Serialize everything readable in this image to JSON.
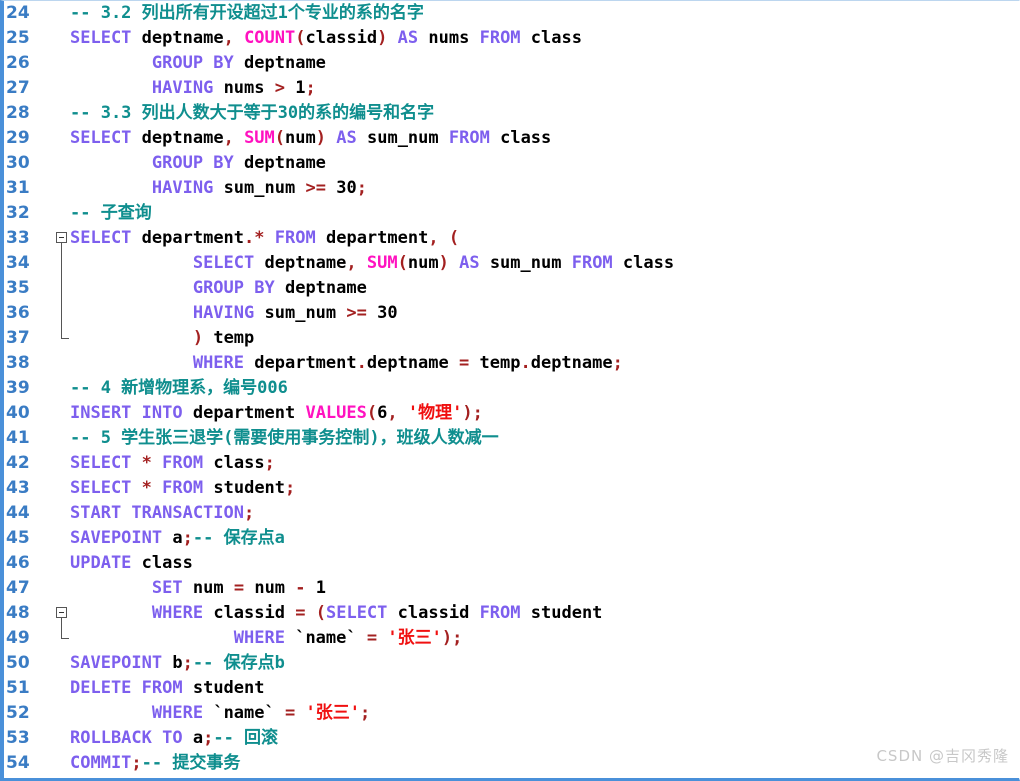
{
  "editor": {
    "language": "sql",
    "first_line": 24,
    "last_line": 54,
    "colors": {
      "background": "#ffffff",
      "line_number": "#3a7cc4",
      "comment": "#0f8e8e",
      "keyword": "#7d5fee",
      "function": "#ff12c0",
      "identifier": "#000000",
      "operator": "#a32020",
      "string": "#f01010",
      "border": "#4a90d9",
      "watermark": "#c8c8c8"
    }
  },
  "watermark": {
    "text": "CSDN @吉冈秀隆"
  },
  "fold_markers": [
    {
      "line": 33,
      "state": "expanded",
      "ends_at_line": 37
    },
    {
      "line": 48,
      "state": "expanded",
      "ends_at_line": 49
    }
  ],
  "lines": [
    {
      "no": "24",
      "plain": "-- 3.2 列出所有开设超过1个专业的系的名字",
      "tokens": [
        {
          "t": "-- 3.2 列出所有开设超过1个专业的系的名字",
          "c": "cm"
        }
      ]
    },
    {
      "no": "25",
      "plain": "SELECT deptname, COUNT(classid) AS nums FROM class",
      "tokens": [
        {
          "t": "SELECT",
          "c": "kw"
        },
        {
          "t": " ",
          "c": "id"
        },
        {
          "t": "deptname",
          "c": "id"
        },
        {
          "t": ",",
          "c": "op"
        },
        {
          "t": " ",
          "c": "id"
        },
        {
          "t": "COUNT",
          "c": "fn"
        },
        {
          "t": "(",
          "c": "op"
        },
        {
          "t": "classid",
          "c": "id"
        },
        {
          "t": ")",
          "c": "op"
        },
        {
          "t": " ",
          "c": "id"
        },
        {
          "t": "AS",
          "c": "kw"
        },
        {
          "t": " ",
          "c": "id"
        },
        {
          "t": "nums",
          "c": "id"
        },
        {
          "t": " ",
          "c": "id"
        },
        {
          "t": "FROM",
          "c": "kw"
        },
        {
          "t": " ",
          "c": "id"
        },
        {
          "t": "class",
          "c": "id"
        }
      ]
    },
    {
      "no": "26",
      "plain": "        GROUP BY deptname",
      "tokens": [
        {
          "t": "        ",
          "c": "id"
        },
        {
          "t": "GROUP BY",
          "c": "kw"
        },
        {
          "t": " ",
          "c": "id"
        },
        {
          "t": "deptname",
          "c": "id"
        }
      ]
    },
    {
      "no": "27",
      "plain": "        HAVING nums > 1;",
      "tokens": [
        {
          "t": "        ",
          "c": "id"
        },
        {
          "t": "HAVING",
          "c": "kw"
        },
        {
          "t": " ",
          "c": "id"
        },
        {
          "t": "nums",
          "c": "id"
        },
        {
          "t": " ",
          "c": "id"
        },
        {
          "t": ">",
          "c": "op"
        },
        {
          "t": " ",
          "c": "id"
        },
        {
          "t": "1",
          "c": "num"
        },
        {
          "t": ";",
          "c": "op"
        }
      ]
    },
    {
      "no": "28",
      "plain": "-- 3.3 列出人数大于等于30的系的编号和名字",
      "tokens": [
        {
          "t": "-- 3.3 列出人数大于等于30的系的编号和名字",
          "c": "cm"
        }
      ]
    },
    {
      "no": "29",
      "plain": "SELECT deptname, SUM(num) AS sum_num FROM class",
      "tokens": [
        {
          "t": "SELECT",
          "c": "kw"
        },
        {
          "t": " ",
          "c": "id"
        },
        {
          "t": "deptname",
          "c": "id"
        },
        {
          "t": ",",
          "c": "op"
        },
        {
          "t": " ",
          "c": "id"
        },
        {
          "t": "SUM",
          "c": "fn"
        },
        {
          "t": "(",
          "c": "op"
        },
        {
          "t": "num",
          "c": "id"
        },
        {
          "t": ")",
          "c": "op"
        },
        {
          "t": " ",
          "c": "id"
        },
        {
          "t": "AS",
          "c": "kw"
        },
        {
          "t": " ",
          "c": "id"
        },
        {
          "t": "sum_num",
          "c": "id"
        },
        {
          "t": " ",
          "c": "id"
        },
        {
          "t": "FROM",
          "c": "kw"
        },
        {
          "t": " ",
          "c": "id"
        },
        {
          "t": "class",
          "c": "id"
        }
      ]
    },
    {
      "no": "30",
      "plain": "        GROUP BY deptname",
      "tokens": [
        {
          "t": "        ",
          "c": "id"
        },
        {
          "t": "GROUP BY",
          "c": "kw"
        },
        {
          "t": " ",
          "c": "id"
        },
        {
          "t": "deptname",
          "c": "id"
        }
      ]
    },
    {
      "no": "31",
      "plain": "        HAVING sum_num >= 30;",
      "tokens": [
        {
          "t": "        ",
          "c": "id"
        },
        {
          "t": "HAVING",
          "c": "kw"
        },
        {
          "t": " ",
          "c": "id"
        },
        {
          "t": "sum_num",
          "c": "id"
        },
        {
          "t": " ",
          "c": "id"
        },
        {
          "t": ">=",
          "c": "op"
        },
        {
          "t": " ",
          "c": "id"
        },
        {
          "t": "30",
          "c": "num"
        },
        {
          "t": ";",
          "c": "op"
        }
      ]
    },
    {
      "no": "32",
      "plain": "-- 子查询",
      "tokens": [
        {
          "t": "-- 子查询",
          "c": "cm"
        }
      ]
    },
    {
      "no": "33",
      "plain": "SELECT department.* FROM department, (",
      "tokens": [
        {
          "t": "SELECT",
          "c": "kw"
        },
        {
          "t": " ",
          "c": "id"
        },
        {
          "t": "department",
          "c": "id"
        },
        {
          "t": ".",
          "c": "op"
        },
        {
          "t": "*",
          "c": "op"
        },
        {
          "t": " ",
          "c": "id"
        },
        {
          "t": "FROM",
          "c": "kw"
        },
        {
          "t": " ",
          "c": "id"
        },
        {
          "t": "department",
          "c": "id"
        },
        {
          "t": ",",
          "c": "op"
        },
        {
          "t": " ",
          "c": "id"
        },
        {
          "t": "(",
          "c": "op"
        }
      ]
    },
    {
      "no": "34",
      "plain": "            SELECT deptname, SUM(num) AS sum_num FROM class",
      "tokens": [
        {
          "t": "            ",
          "c": "id"
        },
        {
          "t": "SELECT",
          "c": "kw"
        },
        {
          "t": " ",
          "c": "id"
        },
        {
          "t": "deptname",
          "c": "id"
        },
        {
          "t": ",",
          "c": "op"
        },
        {
          "t": " ",
          "c": "id"
        },
        {
          "t": "SUM",
          "c": "fn"
        },
        {
          "t": "(",
          "c": "op"
        },
        {
          "t": "num",
          "c": "id"
        },
        {
          "t": ")",
          "c": "op"
        },
        {
          "t": " ",
          "c": "id"
        },
        {
          "t": "AS",
          "c": "kw"
        },
        {
          "t": " ",
          "c": "id"
        },
        {
          "t": "sum_num",
          "c": "id"
        },
        {
          "t": " ",
          "c": "id"
        },
        {
          "t": "FROM",
          "c": "kw"
        },
        {
          "t": " ",
          "c": "id"
        },
        {
          "t": "class",
          "c": "id"
        }
      ]
    },
    {
      "no": "35",
      "plain": "            GROUP BY deptname",
      "tokens": [
        {
          "t": "            ",
          "c": "id"
        },
        {
          "t": "GROUP BY",
          "c": "kw"
        },
        {
          "t": " ",
          "c": "id"
        },
        {
          "t": "deptname",
          "c": "id"
        }
      ]
    },
    {
      "no": "36",
      "plain": "            HAVING sum_num >= 30",
      "tokens": [
        {
          "t": "            ",
          "c": "id"
        },
        {
          "t": "HAVING",
          "c": "kw"
        },
        {
          "t": " ",
          "c": "id"
        },
        {
          "t": "sum_num",
          "c": "id"
        },
        {
          "t": " ",
          "c": "id"
        },
        {
          "t": ">=",
          "c": "op"
        },
        {
          "t": " ",
          "c": "id"
        },
        {
          "t": "30",
          "c": "num"
        }
      ]
    },
    {
      "no": "37",
      "plain": "            ) temp",
      "tokens": [
        {
          "t": "            ",
          "c": "id"
        },
        {
          "t": ")",
          "c": "op"
        },
        {
          "t": " ",
          "c": "id"
        },
        {
          "t": "temp",
          "c": "id"
        }
      ]
    },
    {
      "no": "38",
      "plain": "            WHERE department.deptname = temp.deptname;",
      "tokens": [
        {
          "t": "            ",
          "c": "id"
        },
        {
          "t": "WHERE",
          "c": "kw"
        },
        {
          "t": " ",
          "c": "id"
        },
        {
          "t": "department",
          "c": "id"
        },
        {
          "t": ".",
          "c": "op"
        },
        {
          "t": "deptname",
          "c": "id"
        },
        {
          "t": " ",
          "c": "id"
        },
        {
          "t": "=",
          "c": "op"
        },
        {
          "t": " ",
          "c": "id"
        },
        {
          "t": "temp",
          "c": "id"
        },
        {
          "t": ".",
          "c": "op"
        },
        {
          "t": "deptname",
          "c": "id"
        },
        {
          "t": ";",
          "c": "op"
        }
      ]
    },
    {
      "no": "39",
      "plain": "-- 4 新增物理系，编号006",
      "tokens": [
        {
          "t": "-- 4 新增物理系，编号006",
          "c": "cm"
        }
      ]
    },
    {
      "no": "40",
      "plain": "INSERT INTO department VALUES(6, '物理');",
      "tokens": [
        {
          "t": "INSERT INTO",
          "c": "kw"
        },
        {
          "t": " ",
          "c": "id"
        },
        {
          "t": "department",
          "c": "id"
        },
        {
          "t": " ",
          "c": "id"
        },
        {
          "t": "VALUES",
          "c": "fn"
        },
        {
          "t": "(",
          "c": "op"
        },
        {
          "t": "6",
          "c": "num"
        },
        {
          "t": ",",
          "c": "op"
        },
        {
          "t": " ",
          "c": "id"
        },
        {
          "t": "'物理'",
          "c": "st"
        },
        {
          "t": ")",
          "c": "op"
        },
        {
          "t": ";",
          "c": "op"
        }
      ]
    },
    {
      "no": "41",
      "plain": "-- 5 学生张三退学(需要使用事务控制)，班级人数减一",
      "tokens": [
        {
          "t": "-- 5 学生张三退学(需要使用事务控制)，班级人数减一",
          "c": "cm"
        }
      ]
    },
    {
      "no": "42",
      "plain": "SELECT * FROM class;",
      "tokens": [
        {
          "t": "SELECT",
          "c": "kw"
        },
        {
          "t": " ",
          "c": "id"
        },
        {
          "t": "*",
          "c": "op"
        },
        {
          "t": " ",
          "c": "id"
        },
        {
          "t": "FROM",
          "c": "kw"
        },
        {
          "t": " ",
          "c": "id"
        },
        {
          "t": "class",
          "c": "id"
        },
        {
          "t": ";",
          "c": "op"
        }
      ]
    },
    {
      "no": "43",
      "plain": "SELECT * FROM student;",
      "tokens": [
        {
          "t": "SELECT",
          "c": "kw"
        },
        {
          "t": " ",
          "c": "id"
        },
        {
          "t": "*",
          "c": "op"
        },
        {
          "t": " ",
          "c": "id"
        },
        {
          "t": "FROM",
          "c": "kw"
        },
        {
          "t": " ",
          "c": "id"
        },
        {
          "t": "student",
          "c": "id"
        },
        {
          "t": ";",
          "c": "op"
        }
      ]
    },
    {
      "no": "44",
      "plain": "START TRANSACTION;",
      "tokens": [
        {
          "t": "START TRANSACTION",
          "c": "kw"
        },
        {
          "t": ";",
          "c": "op"
        }
      ]
    },
    {
      "no": "45",
      "plain": "SAVEPOINT a;-- 保存点a",
      "tokens": [
        {
          "t": "SAVEPOINT",
          "c": "kw"
        },
        {
          "t": " ",
          "c": "id"
        },
        {
          "t": "a",
          "c": "id"
        },
        {
          "t": ";",
          "c": "op"
        },
        {
          "t": "-- 保存点a",
          "c": "cm"
        }
      ]
    },
    {
      "no": "46",
      "plain": "UPDATE class",
      "tokens": [
        {
          "t": "UPDATE",
          "c": "kw"
        },
        {
          "t": " ",
          "c": "id"
        },
        {
          "t": "class",
          "c": "id"
        }
      ]
    },
    {
      "no": "47",
      "plain": "        SET num = num - 1",
      "tokens": [
        {
          "t": "        ",
          "c": "id"
        },
        {
          "t": "SET",
          "c": "kw"
        },
        {
          "t": " ",
          "c": "id"
        },
        {
          "t": "num",
          "c": "id"
        },
        {
          "t": " ",
          "c": "id"
        },
        {
          "t": "=",
          "c": "op"
        },
        {
          "t": " ",
          "c": "id"
        },
        {
          "t": "num",
          "c": "id"
        },
        {
          "t": " ",
          "c": "id"
        },
        {
          "t": "-",
          "c": "op"
        },
        {
          "t": " ",
          "c": "id"
        },
        {
          "t": "1",
          "c": "num"
        }
      ]
    },
    {
      "no": "48",
      "plain": "        WHERE classid = (SELECT classid FROM student",
      "tokens": [
        {
          "t": "        ",
          "c": "id"
        },
        {
          "t": "WHERE",
          "c": "kw"
        },
        {
          "t": " ",
          "c": "id"
        },
        {
          "t": "classid",
          "c": "id"
        },
        {
          "t": " ",
          "c": "id"
        },
        {
          "t": "=",
          "c": "op"
        },
        {
          "t": " ",
          "c": "id"
        },
        {
          "t": "(",
          "c": "op"
        },
        {
          "t": "SELECT",
          "c": "kw"
        },
        {
          "t": " ",
          "c": "id"
        },
        {
          "t": "classid",
          "c": "id"
        },
        {
          "t": " ",
          "c": "id"
        },
        {
          "t": "FROM",
          "c": "kw"
        },
        {
          "t": " ",
          "c": "id"
        },
        {
          "t": "student",
          "c": "id"
        }
      ]
    },
    {
      "no": "49",
      "plain": "                WHERE `name` = '张三');",
      "tokens": [
        {
          "t": "                ",
          "c": "id"
        },
        {
          "t": "WHERE",
          "c": "kw"
        },
        {
          "t": " ",
          "c": "id"
        },
        {
          "t": "`name`",
          "c": "id"
        },
        {
          "t": " ",
          "c": "id"
        },
        {
          "t": "=",
          "c": "op"
        },
        {
          "t": " ",
          "c": "id"
        },
        {
          "t": "'张三'",
          "c": "st"
        },
        {
          "t": ")",
          "c": "op"
        },
        {
          "t": ";",
          "c": "op"
        }
      ]
    },
    {
      "no": "50",
      "plain": "SAVEPOINT b;-- 保存点b",
      "tokens": [
        {
          "t": "SAVEPOINT",
          "c": "kw"
        },
        {
          "t": " ",
          "c": "id"
        },
        {
          "t": "b",
          "c": "id"
        },
        {
          "t": ";",
          "c": "op"
        },
        {
          "t": "-- 保存点b",
          "c": "cm"
        }
      ]
    },
    {
      "no": "51",
      "plain": "DELETE FROM student",
      "tokens": [
        {
          "t": "DELETE FROM",
          "c": "kw"
        },
        {
          "t": " ",
          "c": "id"
        },
        {
          "t": "student",
          "c": "id"
        }
      ]
    },
    {
      "no": "52",
      "plain": "        WHERE `name` = '张三';",
      "tokens": [
        {
          "t": "        ",
          "c": "id"
        },
        {
          "t": "WHERE",
          "c": "kw"
        },
        {
          "t": " ",
          "c": "id"
        },
        {
          "t": "`name`",
          "c": "id"
        },
        {
          "t": " ",
          "c": "id"
        },
        {
          "t": "=",
          "c": "op"
        },
        {
          "t": " ",
          "c": "id"
        },
        {
          "t": "'张三'",
          "c": "st"
        },
        {
          "t": ";",
          "c": "op"
        }
      ]
    },
    {
      "no": "53",
      "plain": "ROLLBACK TO a;-- 回滚",
      "tokens": [
        {
          "t": "ROLLBACK TO",
          "c": "kw"
        },
        {
          "t": " ",
          "c": "id"
        },
        {
          "t": "a",
          "c": "id"
        },
        {
          "t": ";",
          "c": "op"
        },
        {
          "t": "-- 回滚",
          "c": "cm"
        }
      ]
    },
    {
      "no": "54",
      "plain": "COMMIT;-- 提交事务",
      "tokens": [
        {
          "t": "COMMIT",
          "c": "kw"
        },
        {
          "t": ";",
          "c": "op"
        },
        {
          "t": "-- 提交事务",
          "c": "cm"
        }
      ]
    }
  ]
}
